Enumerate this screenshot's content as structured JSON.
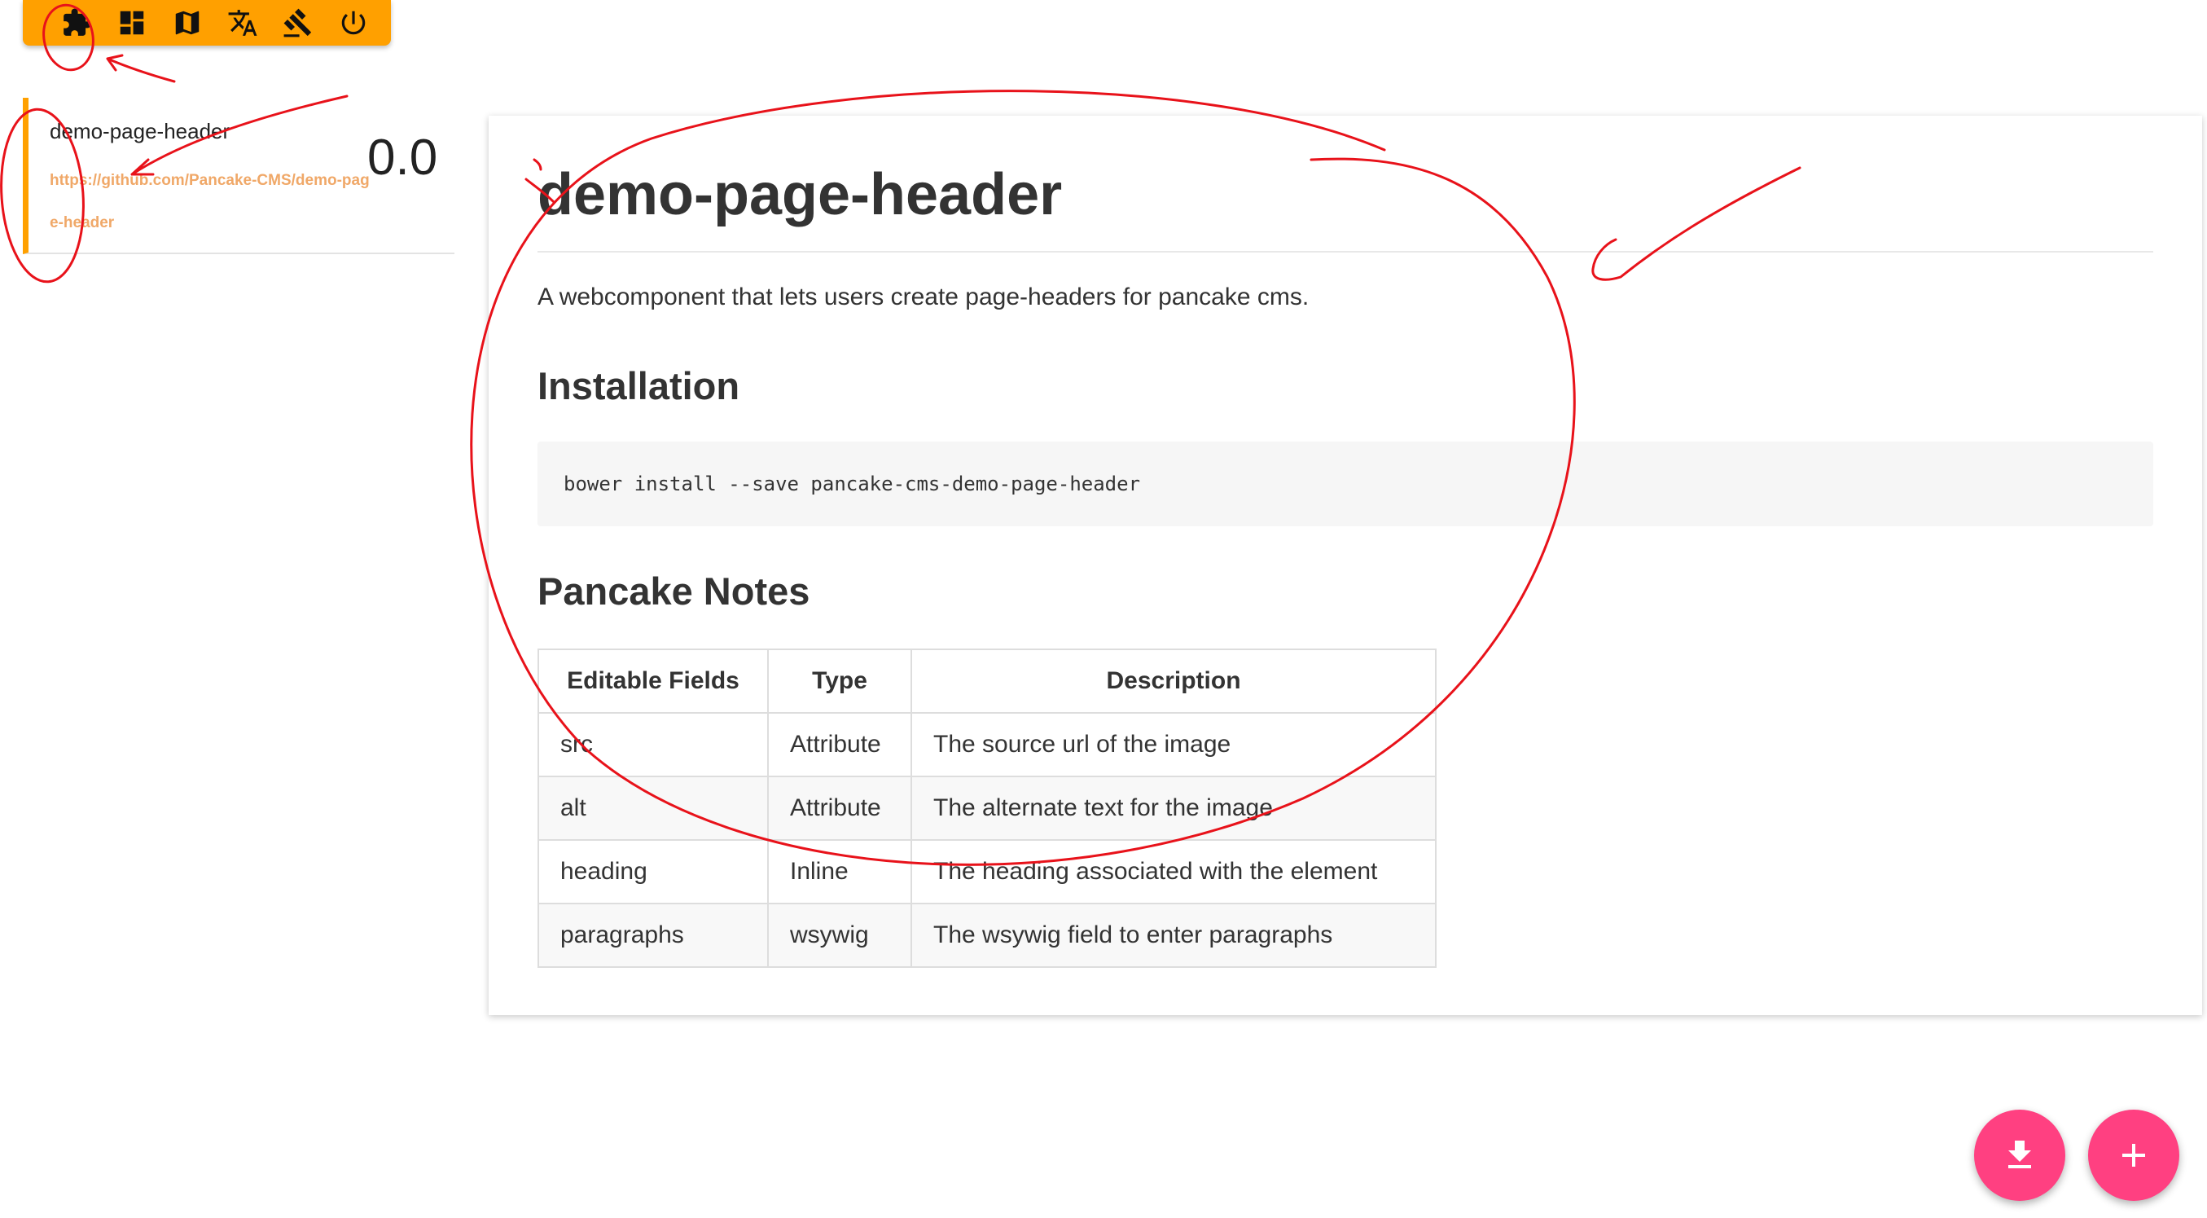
{
  "toolbar": {
    "items": [
      {
        "icon": "puzzle-icon",
        "label": ""
      },
      {
        "icon": "dashboard-icon",
        "label": ""
      },
      {
        "icon": "map-icon",
        "label": ""
      },
      {
        "icon": "translate-icon",
        "label": ""
      },
      {
        "icon": "gavel-icon",
        "label": ""
      },
      {
        "icon": "power-icon",
        "label": ""
      }
    ],
    "color": "#ffa000"
  },
  "sidebar": {
    "component_name": "demo-page-header",
    "link_text": "https://github.com/Pancake-CMS/demo-page-header",
    "version": "0.0"
  },
  "main": {
    "title": "demo-page-header",
    "description": "A webcomponent that lets users create page-headers for pancake cms.",
    "installation_heading": "Installation",
    "install_command": "bower install --save pancake-cms-demo-page-header",
    "notes_heading": "Pancake Notes",
    "table": {
      "headers": [
        "Editable Fields",
        "Type",
        "Description"
      ],
      "rows": [
        [
          "src",
          "Attribute",
          "The source url of the image"
        ],
        [
          "alt",
          "Attribute",
          "The alternate text for the image"
        ],
        [
          "heading",
          "Inline",
          "The heading associated with the element"
        ],
        [
          "paragraphs",
          "wsywig",
          "The wsywig field to enter paragraphs"
        ]
      ]
    }
  },
  "fabs": {
    "download_icon": "download-icon",
    "add_icon": "add-icon",
    "color": "#ff4081"
  },
  "annotation_color": "#e8121a"
}
